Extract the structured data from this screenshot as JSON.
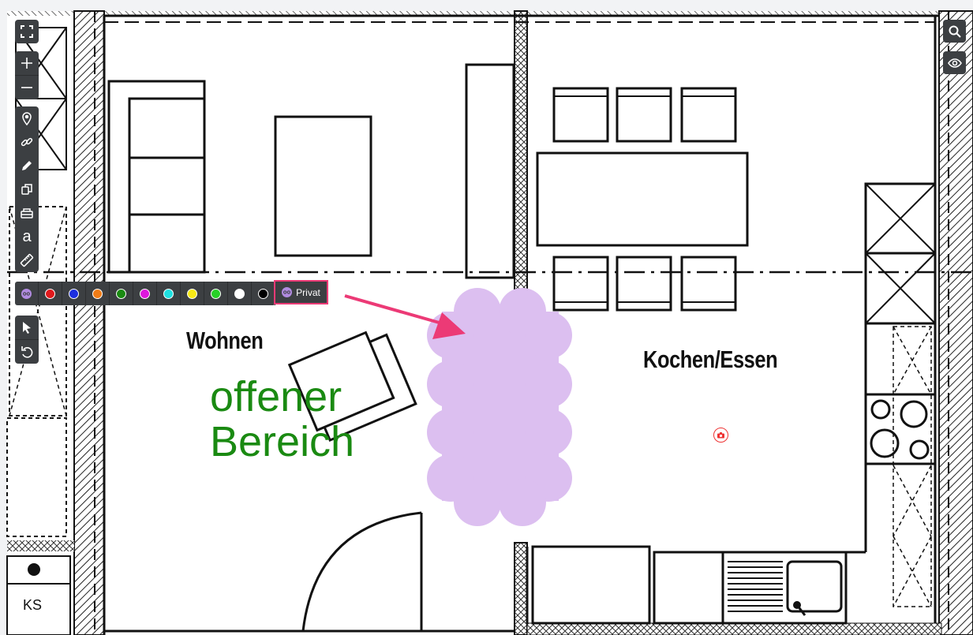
{
  "left_toolbar": {
    "tools": [
      {
        "name": "fullscreen-icon"
      },
      {
        "name": "zoom-in-icon"
      },
      {
        "name": "zoom-out-icon"
      },
      {
        "name": "map-pin-icon"
      },
      {
        "name": "link-icon"
      },
      {
        "name": "pencil-icon"
      },
      {
        "name": "copy-shapes-icon"
      },
      {
        "name": "furniture-icon"
      },
      {
        "name": "text-tool-icon",
        "glyph": "a"
      },
      {
        "name": "ruler-icon"
      },
      {
        "name": "select-pointer-icon"
      },
      {
        "name": "undo-icon"
      }
    ]
  },
  "color_palette": {
    "swatches": [
      "#b18be0",
      "#e0191c",
      "#1d2fe0",
      "#f07c17",
      "#1a8a12",
      "#dd18dd",
      "#1ee0e0",
      "#f7ea17",
      "#27d027",
      "#ffffff",
      "#000000"
    ],
    "selected_label": "Privat",
    "selected_color": "#b18be0"
  },
  "right_toolbar": {
    "tools": [
      {
        "name": "search-icon"
      },
      {
        "name": "eye-icon"
      }
    ]
  },
  "floorplan": {
    "room_labels": {
      "living": "Wohnen",
      "kitchen": "Kochen/Essen",
      "storage": "KS"
    },
    "annotation_text_line1": "offener",
    "annotation_text_line2": "Bereich",
    "annotation_color": "#1a8a12",
    "privacy_cloud_color": "#dcbff0",
    "arrow_color": "#ec3a76"
  }
}
